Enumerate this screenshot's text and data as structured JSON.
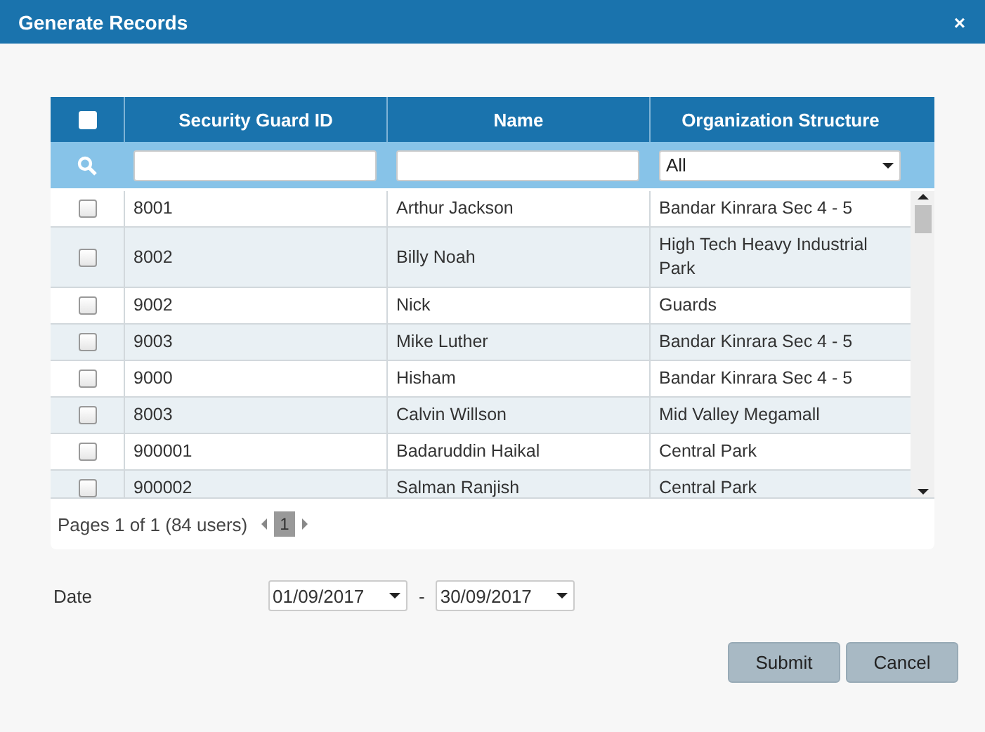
{
  "window": {
    "title": "Generate Records",
    "close": "×"
  },
  "table": {
    "select_all": {
      "checked": false
    },
    "columns": [
      "Security Guard ID",
      "Name",
      "Organization Structure"
    ],
    "filter": {
      "organization": "All"
    },
    "rows": [
      {
        "checked": false,
        "id": "8001",
        "name": "Arthur Jackson",
        "organization": "Bandar Kinrara Sec 4 - 5"
      },
      {
        "checked": false,
        "id": "8002",
        "name": "Billy Noah",
        "organization": "High Tech Heavy Industrial Park"
      },
      {
        "checked": false,
        "id": "9002",
        "name": "Nick",
        "organization": "Guards"
      },
      {
        "checked": false,
        "id": "9003",
        "name": "Mike Luther",
        "organization": "Bandar Kinrara Sec 4 - 5"
      },
      {
        "checked": false,
        "id": "9000",
        "name": "Hisham",
        "organization": "Bandar Kinrara Sec 4 - 5"
      },
      {
        "checked": false,
        "id": "8003",
        "name": "Calvin Willson",
        "organization": "Mid Valley Megamall"
      },
      {
        "checked": false,
        "id": "900001",
        "name": "Badaruddin Haikal",
        "organization": "Central Park"
      },
      {
        "checked": false,
        "id": "900002",
        "name": "Salman Ranjish",
        "organization": "Central Park"
      }
    ],
    "pager": {
      "summary": "Pages 1 of 1 (84 users)",
      "pages": [
        {
          "label": "1",
          "selected": true
        }
      ]
    }
  },
  "date": {
    "label": "Date",
    "from": "01/09/2017",
    "separator": "-",
    "to": "30/09/2017"
  },
  "buttons": [
    "Submit",
    "Cancel"
  ]
}
